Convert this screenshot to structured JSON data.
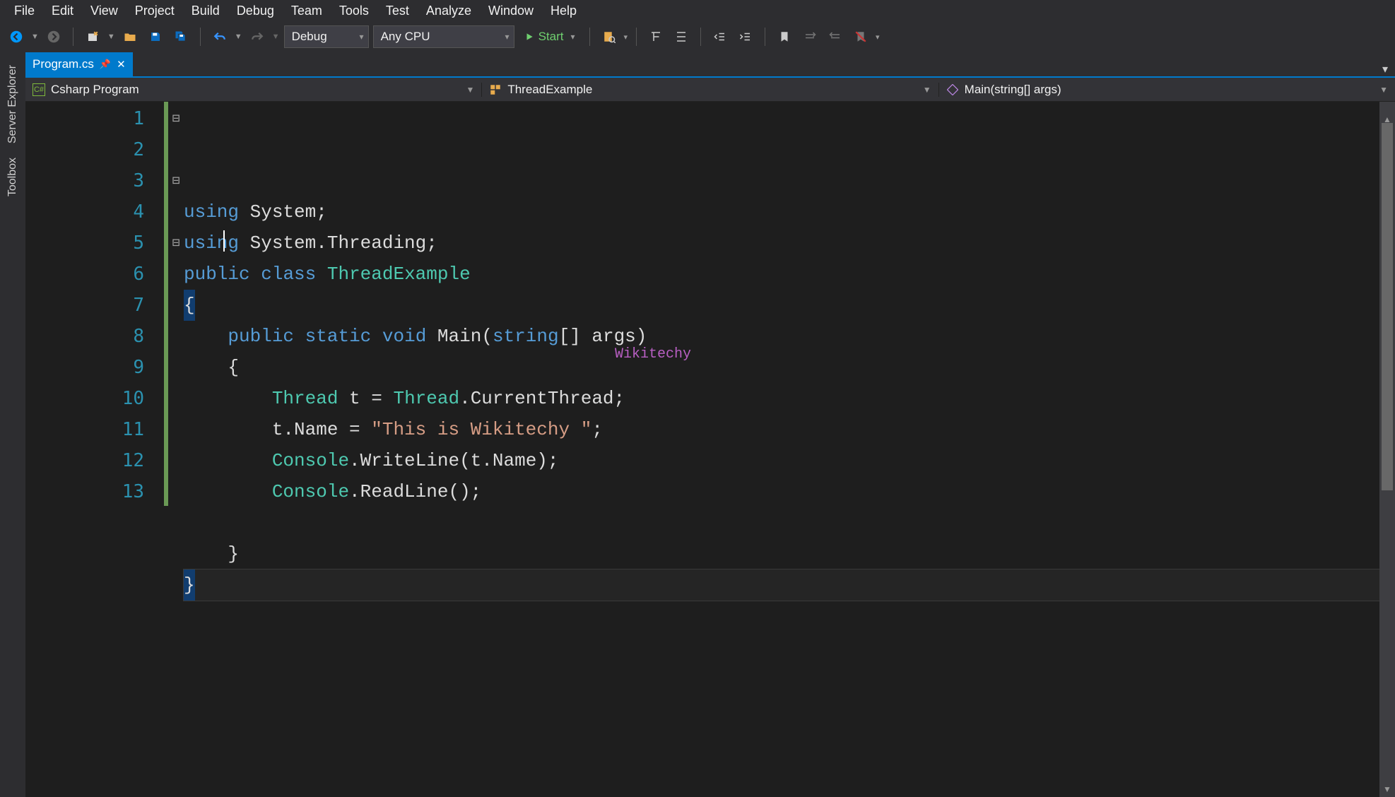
{
  "menubar": [
    "File",
    "Edit",
    "View",
    "Project",
    "Build",
    "Debug",
    "Team",
    "Tools",
    "Test",
    "Analyze",
    "Window",
    "Help"
  ],
  "toolbar": {
    "config_label": "Debug",
    "platform_label": "Any CPU",
    "start_label": "Start"
  },
  "left_rail": {
    "server_explorer": "Server Explorer",
    "toolbox": "Toolbox"
  },
  "tab": {
    "title": "Program.cs"
  },
  "navbar": {
    "project_label": "Csharp Program",
    "type_label": "ThreadExample",
    "member_label": "Main(string[] args)"
  },
  "editor": {
    "watermark": "Wikitechy",
    "line_numbers": [
      "1",
      "2",
      "3",
      "4",
      "5",
      "6",
      "7",
      "8",
      "9",
      "10",
      "11",
      "12",
      "13"
    ],
    "fold": [
      "⊟",
      "",
      "⊟",
      "",
      "⊟",
      "",
      "",
      "",
      "",
      "",
      "",
      "",
      ""
    ],
    "lines": [
      [
        [
          "kw",
          "using"
        ],
        [
          "pln",
          " System;"
        ]
      ],
      [
        [
          "kw",
          "using"
        ],
        [
          "pln",
          " System.Threading;"
        ]
      ],
      [
        [
          "kw",
          "public"
        ],
        [
          "pln",
          " "
        ],
        [
          "kw",
          "class"
        ],
        [
          "pln",
          " "
        ],
        [
          "typ",
          "ThreadExample"
        ]
      ],
      [
        [
          "pln",
          "{"
        ]
      ],
      [
        [
          "pln",
          "    "
        ],
        [
          "kw",
          "public"
        ],
        [
          "pln",
          " "
        ],
        [
          "kw",
          "static"
        ],
        [
          "pln",
          " "
        ],
        [
          "kw",
          "void"
        ],
        [
          "pln",
          " Main("
        ],
        [
          "kw",
          "string"
        ],
        [
          "pln",
          "[] args)"
        ]
      ],
      [
        [
          "pln",
          "    {"
        ]
      ],
      [
        [
          "pln",
          "        "
        ],
        [
          "typ",
          "Thread"
        ],
        [
          "pln",
          " t = "
        ],
        [
          "typ",
          "Thread"
        ],
        [
          "pln",
          ".CurrentThread;"
        ]
      ],
      [
        [
          "pln",
          "        t.Name = "
        ],
        [
          "str",
          "\"This is Wikitechy \""
        ],
        [
          "pln",
          ";"
        ]
      ],
      [
        [
          "pln",
          "        "
        ],
        [
          "typ",
          "Console"
        ],
        [
          "pln",
          ".WriteLine(t.Name);"
        ]
      ],
      [
        [
          "pln",
          "        "
        ],
        [
          "typ",
          "Console"
        ],
        [
          "pln",
          ".ReadLine();"
        ]
      ],
      [
        [
          "pln",
          ""
        ]
      ],
      [
        [
          "pln",
          "    }"
        ]
      ],
      [
        [
          "pln",
          "}"
        ]
      ]
    ]
  }
}
